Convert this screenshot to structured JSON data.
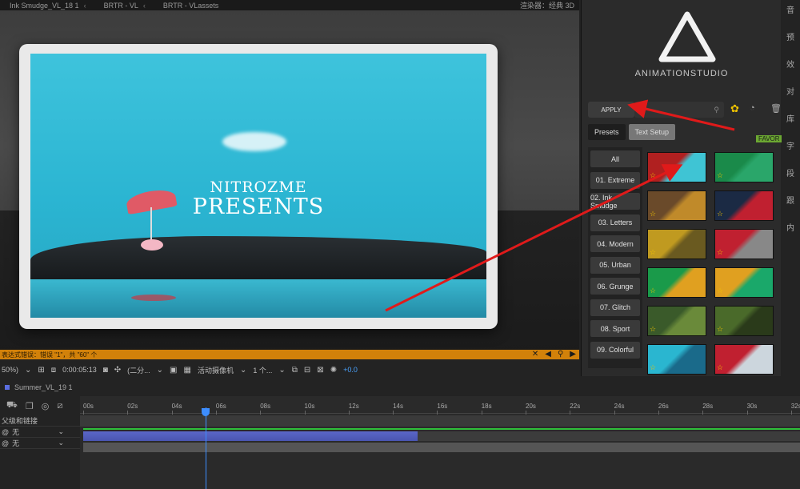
{
  "topbar": {
    "tabs": [
      "Ink Smudge_VL_18 1",
      "BRTR - VL",
      "BRTR - VLassets"
    ],
    "renderer": "渲染器：经典 3D"
  },
  "viewer": {
    "title_small": "NITROZME",
    "title_big": "PRESENTS"
  },
  "errbar": {
    "message": "表达式错误：错误 \"1\"，共 \"60\" 个"
  },
  "viewer_toolbar": {
    "zoom": "50%)",
    "timecode": "0:00:05:13",
    "resolution": "(二分...",
    "camera": "活动摄像机",
    "views": "1 个...",
    "exposure": "+0.0"
  },
  "timeline": {
    "comp_name": "Summer_VL_19 1",
    "parent_header": "父级和链接",
    "rows": [
      {
        "parent": "无"
      },
      {
        "parent": "无"
      }
    ],
    "ticks": [
      "00s",
      "02s",
      "04s",
      "06s",
      "08s",
      "10s",
      "12s",
      "14s",
      "16s",
      "18s",
      "20s",
      "22s",
      "24s",
      "26s",
      "28s",
      "30s",
      "32s"
    ],
    "playhead_fraction": 0.17
  },
  "panel": {
    "brand": "ANIMATIONSTUDIO",
    "apply_label": "APPLY",
    "tabs": [
      "Presets",
      "Text Setup"
    ],
    "favor_label": "FAVOR",
    "categories": [
      "All",
      "01. Extreme",
      "02. Ink Smudge",
      "03. Letters",
      "04. Modern",
      "05. Urban",
      "06. Grunge",
      "07. Glitch",
      "08. Sport",
      "09. Colorful"
    ],
    "thumbnails": [
      {
        "colors": [
          "#b02020",
          "#3fc4d4"
        ]
      },
      {
        "colors": [
          "#1a8a4a",
          "#2aa66a"
        ]
      },
      {
        "colors": [
          "#6a4a2a",
          "#c08a2a"
        ]
      },
      {
        "colors": [
          "#1b2a44",
          "#c02030"
        ]
      },
      {
        "colors": [
          "#c09a20",
          "#6a5a20"
        ]
      },
      {
        "colors": [
          "#c02030",
          "#888888"
        ]
      },
      {
        "colors": [
          "#1a9a4a",
          "#e0a020"
        ]
      },
      {
        "colors": [
          "#e0a020",
          "#1aa86a"
        ]
      },
      {
        "colors": [
          "#3a5a2a",
          "#6a8a3a"
        ]
      },
      {
        "colors": [
          "#4a6a2a",
          "#2a3a1a"
        ]
      },
      {
        "colors": [
          "#2ab6d0",
          "#1a6a8a"
        ]
      },
      {
        "colors": [
          "#c02030",
          "#ccd6dd"
        ]
      }
    ]
  },
  "strip": {
    "labels": [
      "音",
      "预",
      "效",
      "对",
      "库",
      "字",
      "段",
      "跟",
      "内"
    ]
  },
  "colors": {
    "accent": "#f0c400",
    "error": "#d2810a",
    "playhead": "#3d8dff",
    "layer": "#5b66c8",
    "arrow": "#e01a1a"
  }
}
